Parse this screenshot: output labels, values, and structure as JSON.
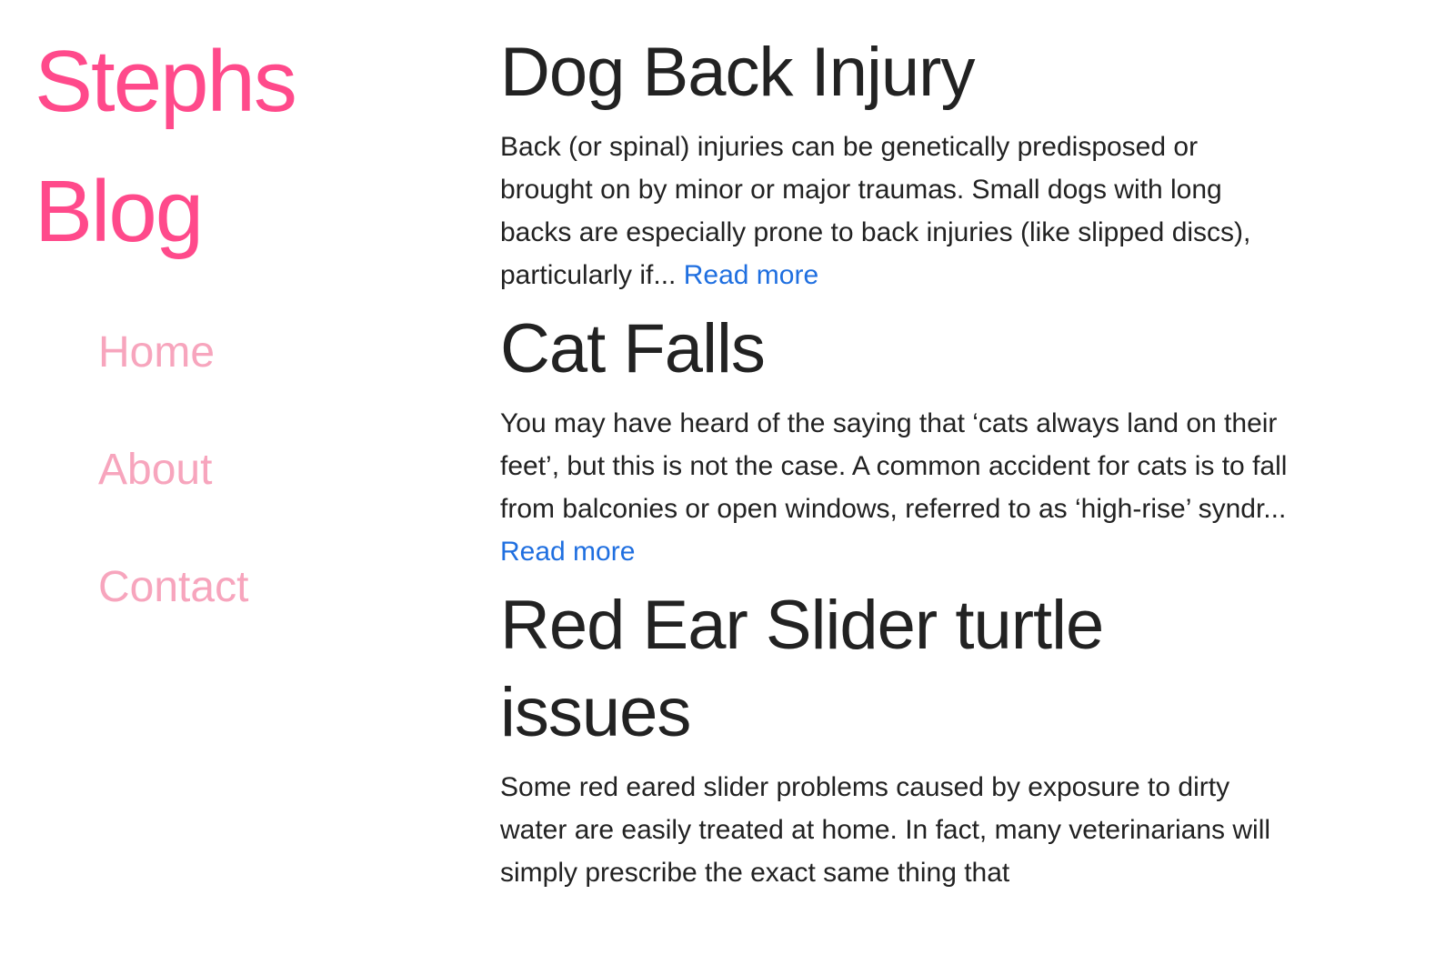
{
  "site": {
    "title_line1": "Stephs",
    "title_line2": "Blog",
    "accent_color": "#ff4a8b"
  },
  "nav": {
    "items": [
      {
        "label": "Home"
      },
      {
        "label": "About"
      },
      {
        "label": "Contact"
      }
    ],
    "color": "#f7a5bd"
  },
  "posts": [
    {
      "title": "Dog Back Injury",
      "excerpt": "Back (or spinal) injuries can be genetically predisposed or brought on by minor or major traumas. Small dogs with long backs are especially prone to back injuries (like slipped discs), particularly if...",
      "read_more": "Read more"
    },
    {
      "title": "Cat Falls",
      "excerpt": "You may have heard of the saying that ‘cats always land on their feet’, but this is not the case. A common accident for cats is to fall from balconies or open windows, referred to as ‘high-rise’ syndr...",
      "read_more": "Read more"
    },
    {
      "title": "Red Ear Slider turtle issues",
      "excerpt": "Some red eared slider problems caused by exposure to dirty water are easily treated at home. In fact, many veterinarians will simply prescribe the exact same thing that",
      "read_more": ""
    }
  ],
  "link_color": "#1f6fe0"
}
